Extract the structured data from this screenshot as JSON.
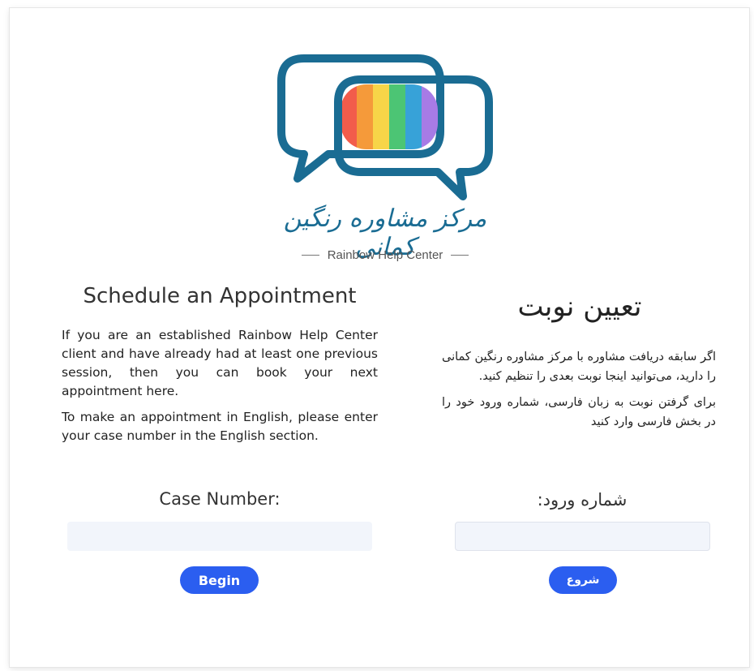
{
  "logo": {
    "icon": "rainbow-speech-bubbles-logo",
    "script_text": "مرکز مشاوره رنگین کمانی",
    "tagline": "Rainbow Help Center",
    "colors": {
      "outline": "#1a6c93",
      "rainbow": [
        "#f25c4b",
        "#f59a3a",
        "#f7d548",
        "#4cc574",
        "#37a2d8",
        "#a77be6"
      ]
    }
  },
  "english": {
    "title": "Schedule an Appointment",
    "paragraph1": "If you are an established Rainbow Help Center client and have already had at least one previous session, then you can book your next appointment here.",
    "paragraph2": "To make an appointment in English, please enter your case number in the English section.",
    "field_label": "Case Number:",
    "field_value": "",
    "button_label": "Begin"
  },
  "persian": {
    "title": "تعیین نوبت",
    "paragraph1": "اگر سابقه دریافت مشاوره با مرکز مشاوره رنگین کمانی را دارید، می‌توانید اینجا نوبت بعدی را تنظیم کنید.",
    "paragraph2": "برای گرفتن نوبت به زبان فارسی، شماره ورود خود را در بخش فارسی وارد کنید",
    "field_label": "شماره ورود:",
    "field_value": "",
    "button_label": "شروع"
  },
  "theme": {
    "button_color": "#2b5ef0",
    "input_bg": "#f2f5fb"
  }
}
